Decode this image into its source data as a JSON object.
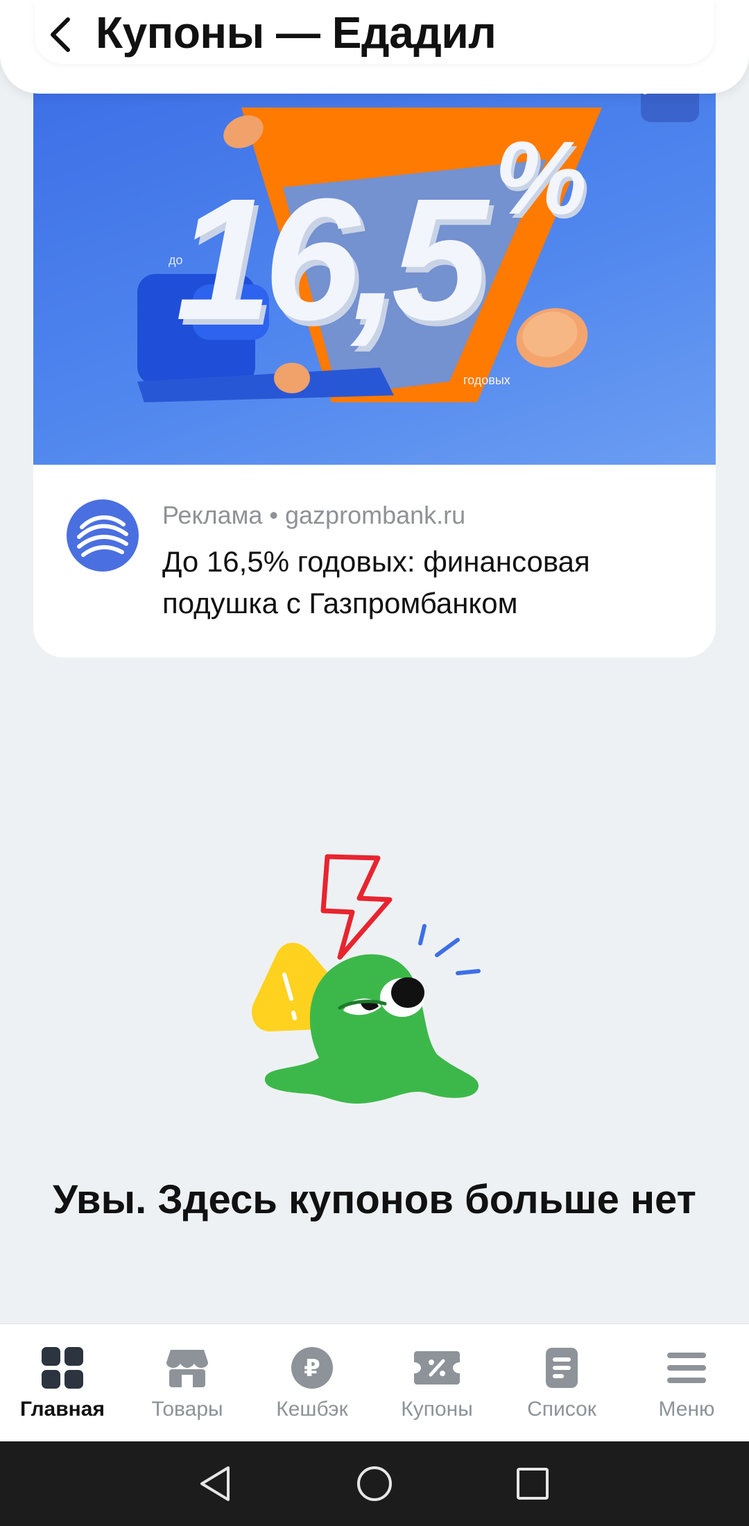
{
  "header": {
    "title": "Купоны — Едадил",
    "back_icon": "chevron-left-icon"
  },
  "ad": {
    "banner": {
      "prefix": "до",
      "big_number": "16,5",
      "percent": "%",
      "suffix": "годовых"
    },
    "meta_label": "Реклама",
    "meta_separator": "•",
    "meta_domain": "gazprombank.ru",
    "text": "До 16,5% годовых: финансовая подушка с Газпромбанком",
    "menu_icon": "more-vertical-icon",
    "logo_icon": "gazprombank-logo-icon"
  },
  "empty_state": {
    "title": "Увы. Здесь купонов больше нет",
    "illustration": "sad-blob-warning-illustration"
  },
  "bottom_nav": {
    "items": [
      {
        "label": "Главная",
        "icon": "grid-icon",
        "active": true
      },
      {
        "label": "Товары",
        "icon": "store-icon",
        "active": false
      },
      {
        "label": "Кешбэк",
        "icon": "ruble-coin-icon",
        "active": false
      },
      {
        "label": "Купоны",
        "icon": "coupon-percent-icon",
        "active": false
      },
      {
        "label": "Список",
        "icon": "list-doc-icon",
        "active": false
      },
      {
        "label": "Меню",
        "icon": "hamburger-icon",
        "active": false
      }
    ]
  },
  "system_nav": {
    "back": "back-triangle-icon",
    "home": "home-circle-icon",
    "recents": "recents-square-icon"
  },
  "colors": {
    "background": "#eef1f3",
    "banner_blue": "#4f86ee",
    "banner_orange": "#ff7a00",
    "nav_inactive": "#8d9399",
    "nav_active": "#111111",
    "blob_green": "#3cb84a"
  }
}
